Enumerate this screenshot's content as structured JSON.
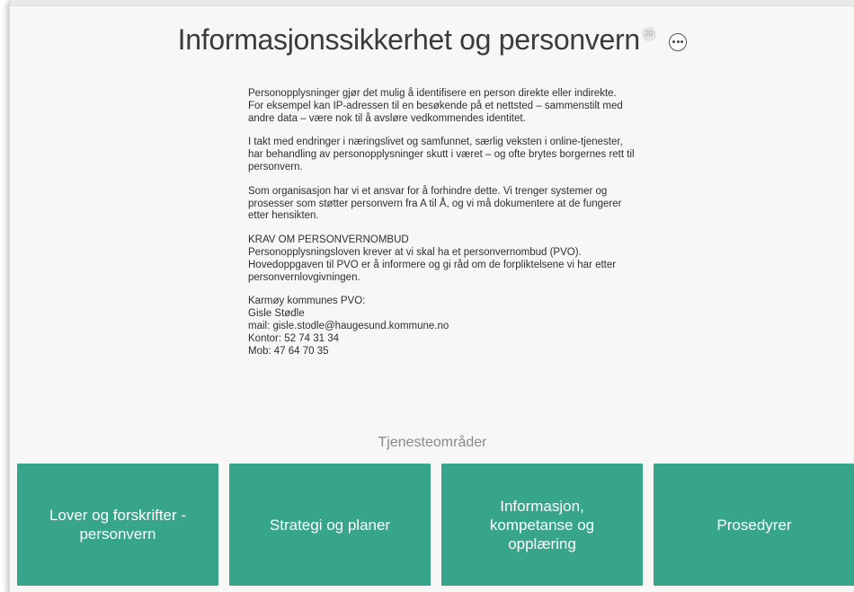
{
  "page": {
    "title": "Informasjonssikkerhet og personvern",
    "badge_count": "20",
    "more_icon": "ellipsis-circle-icon"
  },
  "content": {
    "paragraphs": [
      "Personopplysninger gjør det mulig å identifisere en person direkte eller indirekte. For eksempel kan IP-adressen til en besøkende på et nettsted – sammenstilt med andre data – være nok til å avsløre vedkommendes identitet.",
      "I takt med endringer i næringslivet og samfunnet, særlig veksten i online-tjenester, har behandling av personopplysninger skutt i været – og ofte brytes borgernes rett til personvern.",
      "Som organisasjon har vi et ansvar for å forhindre dette. Vi trenger systemer og prosesser som støtter personvern fra A til Å, og vi må dokumentere at de fungerer etter hensikten."
    ],
    "pvo_heading": "KRAV OM PERSONVERNOMBUD",
    "pvo_text": "Personopplysningsloven krever at vi skal ha et personvernombud (PVO). Hovedoppgaven til PVO er å informere og gi råd om de forpliktelsene vi har etter personvernlovgivningen.",
    "contact": {
      "label": "Karmøy kommunes PVO:",
      "name": "Gisle Stødle",
      "mail": "mail: gisle.stodle@haugesund.kommune.no",
      "office": "Kontor: 52 74 31 34",
      "mobile": "Mob: 47 64 70 35"
    }
  },
  "services": {
    "heading": "Tjenesteområder",
    "tile_color": "#36a58a",
    "tiles": [
      {
        "label": "Lover og forskrifter -\npersonvern"
      },
      {
        "label": "Strategi og planer"
      },
      {
        "label": "Informasjon,\nkompetanse og\nopplæring"
      },
      {
        "label": "Prosedyrer"
      }
    ]
  }
}
